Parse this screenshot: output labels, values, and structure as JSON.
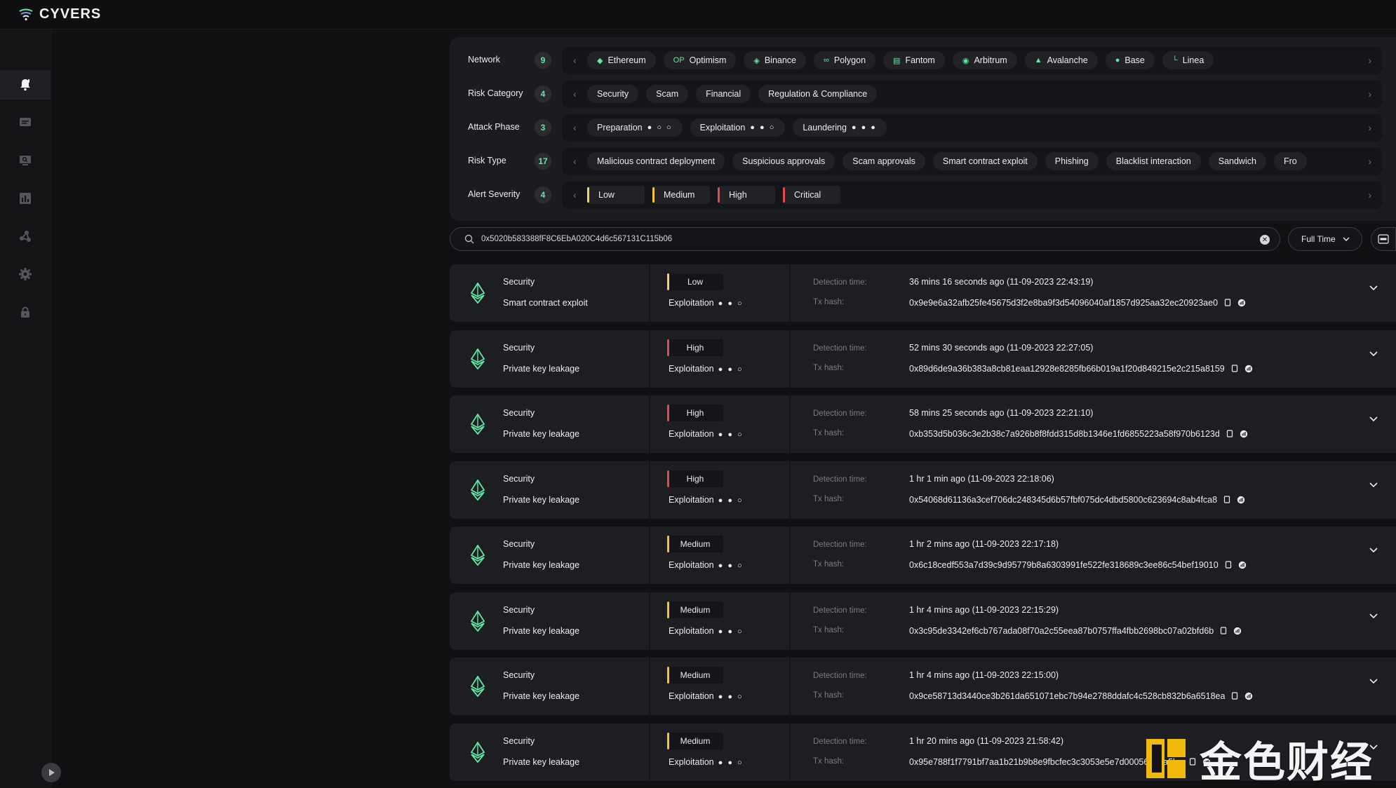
{
  "app": {
    "brand": "CYVERS"
  },
  "sidebar": {
    "items": [
      {
        "icon": "bell-icon"
      },
      {
        "icon": "message-icon"
      },
      {
        "icon": "monitor-search-icon"
      },
      {
        "icon": "bar-chart-icon"
      },
      {
        "icon": "network-icon"
      },
      {
        "icon": "gear-icon"
      },
      {
        "icon": "lock-icon"
      }
    ]
  },
  "filters": {
    "network": {
      "label": "Network",
      "count": "9",
      "chips": [
        "Ethereum",
        "Optimism",
        "Binance",
        "Polygon",
        "Fantom",
        "Arbitrum",
        "Avalanche",
        "Base",
        "Linea"
      ]
    },
    "risk_category": {
      "label": "Risk Category",
      "count": "4",
      "chips": [
        "Security",
        "Scam",
        "Financial",
        "Regulation & Compliance"
      ]
    },
    "attack_phase": {
      "label": "Attack Phase",
      "count": "3",
      "chips": [
        {
          "label": "Preparation",
          "dots": "● ○ ○"
        },
        {
          "label": "Exploitation",
          "dots": "● ● ○"
        },
        {
          "label": "Laundering",
          "dots": "● ● ●"
        }
      ]
    },
    "risk_type": {
      "label": "Risk Type",
      "count": "17",
      "chips": [
        "Malicious contract deployment",
        "Suspicious approvals",
        "Scam approvals",
        "Smart contract exploit",
        "Phishing",
        "Blacklist interaction",
        "Sandwich",
        "Fro"
      ]
    },
    "alert_severity": {
      "label": "Alert Severity",
      "count": "4",
      "chips": [
        {
          "label": "Low",
          "color": "#f4d35e"
        },
        {
          "label": "Medium",
          "color": "#f4c430"
        },
        {
          "label": "High",
          "color": "#e5484d"
        },
        {
          "label": "Critical",
          "color": "#e5484d"
        }
      ]
    }
  },
  "search": {
    "value": "0x5020b583388fF8C6EbA020C4d6c567131C115b06"
  },
  "time_filter": {
    "label": "Full Time"
  },
  "alerts_labels": {
    "detection": "Detection time:",
    "txhash": "Tx hash:"
  },
  "alerts": [
    {
      "category": "Security",
      "type": "Smart contract exploit",
      "severity": "Low",
      "sev_color": "#f4d35e",
      "phase": "Exploitation",
      "dots": "● ● ○",
      "detection": "36 mins 16 seconds ago (11-09-2023 22:43:19)",
      "hash": "0x9e9e6a32afb25fe45675d3f2e8ba9f3d54096040af1857d925aa32ec20923ae0"
    },
    {
      "category": "Security",
      "type": "Private key leakage",
      "severity": "High",
      "sev_color": "#e5484d",
      "phase": "Exploitation",
      "dots": "● ● ○",
      "detection": "52 mins 30 seconds ago (11-09-2023 22:27:05)",
      "hash": "0x89d6de9a36b383a8cb81eaa12928e8285fb66b019a1f20d849215e2c215a8159"
    },
    {
      "category": "Security",
      "type": "Private key leakage",
      "severity": "High",
      "sev_color": "#e5484d",
      "phase": "Exploitation",
      "dots": "● ● ○",
      "detection": "58 mins 25 seconds ago (11-09-2023 22:21:10)",
      "hash": "0xb353d5b036c3e2b38c7a926b8f8fdd315d8b1346e1fd6855223a58f970b6123d"
    },
    {
      "category": "Security",
      "type": "Private key leakage",
      "severity": "High",
      "sev_color": "#e5484d",
      "phase": "Exploitation",
      "dots": "● ● ○",
      "detection": "1 hr 1 min ago (11-09-2023 22:18:06)",
      "hash": "0x54068d61136a3cef706dc248345d6b57fbf075dc4dbd5800c623694c8ab4fca8"
    },
    {
      "category": "Security",
      "type": "Private key leakage",
      "severity": "Medium",
      "sev_color": "#f4c430",
      "phase": "Exploitation",
      "dots": "● ● ○",
      "detection": "1 hr 2 mins ago (11-09-2023 22:17:18)",
      "hash": "0x6c18cedf553a7d39c9d95779b8a6303991fe522fe318689c3ee86c54bef19010"
    },
    {
      "category": "Security",
      "type": "Private key leakage",
      "severity": "Medium",
      "sev_color": "#f4c430",
      "phase": "Exploitation",
      "dots": "● ● ○",
      "detection": "1 hr 4 mins ago (11-09-2023 22:15:29)",
      "hash": "0x3c95de3342ef6cb767ada08f70a2c55eea87b0757ffa4fbb2698bc07a02bfd6b"
    },
    {
      "category": "Security",
      "type": "Private key leakage",
      "severity": "Medium",
      "sev_color": "#f4c430",
      "phase": "Exploitation",
      "dots": "● ● ○",
      "detection": "1 hr 4 mins ago (11-09-2023 22:15:00)",
      "hash": "0x9ce58713d3440ce3b261da651071ebc7b94e2788ddafc4c528cb832b6a6518ea"
    },
    {
      "category": "Security",
      "type": "Private key leakage",
      "severity": "Medium",
      "sev_color": "#f4c430",
      "phase": "Exploitation",
      "dots": "● ● ○",
      "detection": "1 hr 20 mins ago (11-09-2023 21:58:42)",
      "hash": "0x95e788f1f7791bf7aa1b21b9b8e9fbcfec3c3053e5e7d0005698aa5ba"
    }
  ],
  "watermark": {
    "text": "金色财经"
  }
}
